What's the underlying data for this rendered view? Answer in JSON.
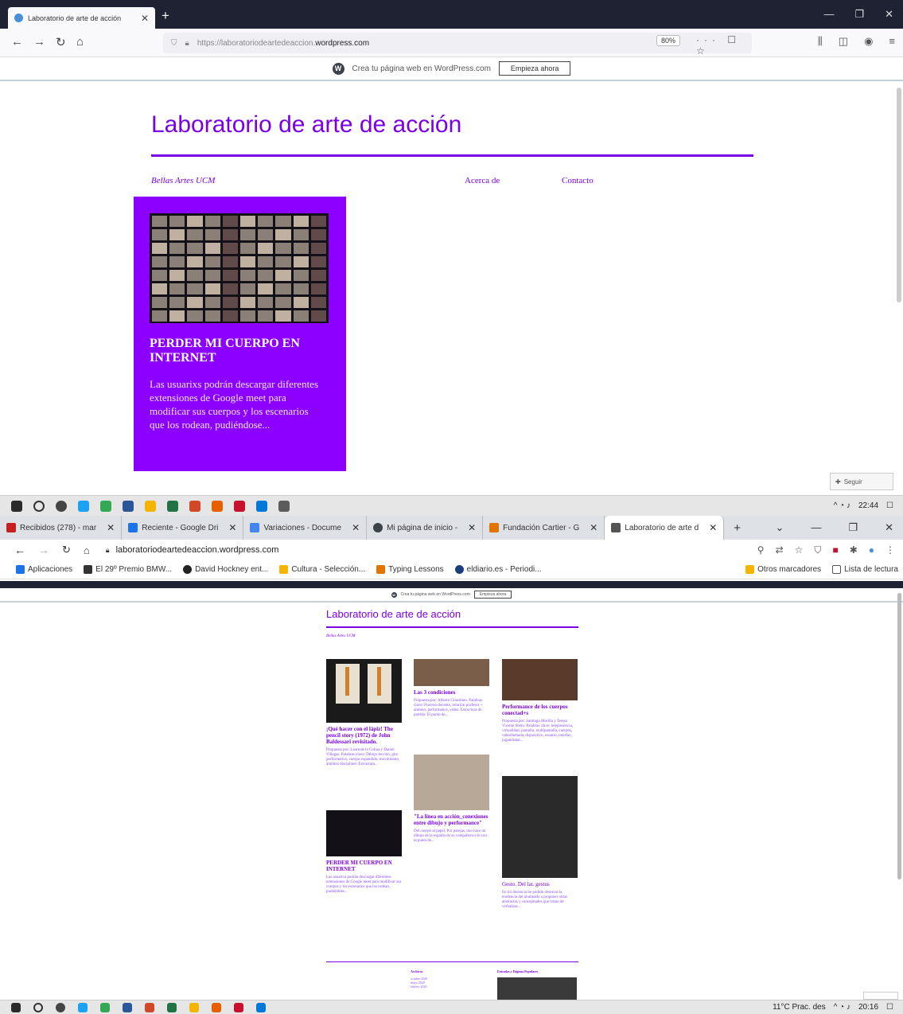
{
  "firefox": {
    "tab_title": "Laboratorio de arte de acción",
    "url_prefix": "https://laboratoriodeartedeaccion.",
    "url_domain": "wordpress.com",
    "zoom": "80%"
  },
  "wp_banner": {
    "text": "Crea tu página web en WordPress.com",
    "button": "Empieza ahora"
  },
  "site": {
    "title": "Laboratorio de arte de acción",
    "menu": [
      "Bellas Artes UCM",
      "Acerca de",
      "Contacto"
    ]
  },
  "card": {
    "title": "PERDER MI CUERPO EN INTERNET",
    "excerpt": "Las usuarixs podrán descargar diferentes extensiones de Google meet para modificar sus cuerpos y los escenarios que los rodean, pudiéndose..."
  },
  "follow": "Seguir",
  "taskbar1": {
    "time": "22:44"
  },
  "chrome": {
    "tabs": [
      {
        "label": "Recibidos (278) - mar",
        "color": "#c5221f"
      },
      {
        "label": "Reciente - Google Dri",
        "color": "#1a73e8"
      },
      {
        "label": "Variaciones - Docume",
        "color": "#4285f4"
      },
      {
        "label": "Mi página de inicio -",
        "color": "#3c434a"
      },
      {
        "label": "Fundación Cartier - G",
        "color": "#e37400"
      },
      {
        "label": "Laboratorio de arte d",
        "color": "#555555"
      }
    ],
    "url": "laboratoriodeartedeaccion.wordpress.com",
    "bookmarks": [
      "Aplicaciones",
      "El 29º Premio BMW...",
      "David Hockney ent...",
      "Cultura - Selección...",
      "Typing Lessons",
      "eldiario.es - Periodi..."
    ],
    "bookmarks_right": [
      "Otros marcadores",
      "Lista de lectura"
    ]
  },
  "inner": {
    "title": "Laboratorio de arte de acción",
    "posts": [
      {
        "title": "¡Qué hacer con el lápiz! The pencil story (1972) de John Baldessari revisitado.",
        "excerpt": "Propuesta por: Laura de la Colina y Daniel Villegas. Palabras clave: Dibujo lección, giro performativo, cuerpo expandido, movimiento, ámbitos discipliner. Estructura..."
      },
      {
        "title": "Las 3 condiciones",
        "excerpt": "Propuesta por: Alberto Ginesbien. Palabras clave: Proceso docente, relación profesor + alumno, performance, video. Estructura de partida: El punto de..."
      },
      {
        "title": "Performance de los cuerpos conectad+s",
        "excerpt": "Propuesta por: Santiago Morilla y Teresa Vicente Sleno. Palabras clave: telepresencia, virtualidad, pantalla, multipantalla, cuerpos, videollamada, dispositivo, usuario, interfaz, jugabilidad..."
      },
      {
        "title": "PERDER MI CUERPO EN INTERNET",
        "excerpt": "Las usuarixs podrán descargar diferentes extensiones de Google meet para modificar sus cuerpos y los escenarios que los rodean, pudiéndose..."
      },
      {
        "title": "\"La línea en acción_conexiones entre dibujo y performance\"",
        "excerpt": "Del cuerpo al papel. Por parejas, uno hace un dibujo de la espalda de su compañero/a le con la punta de..."
      },
      {
        "title": "Gesto. Del lat. gestus",
        "excerpt": "En mi docencia he podido observar la tendencia del alumnado a proponer obras abstractas y conceptuales que tratan de verbalizar..."
      }
    ],
    "footer_heads": [
      "Archivos",
      "Entradas y Páginas Populares"
    ],
    "archives": [
      "octubre 2020",
      "mayo 2020",
      "febrero 2020"
    ]
  },
  "taskbar2": {
    "weather": "11°C  Prac. des",
    "time": "20:16"
  }
}
